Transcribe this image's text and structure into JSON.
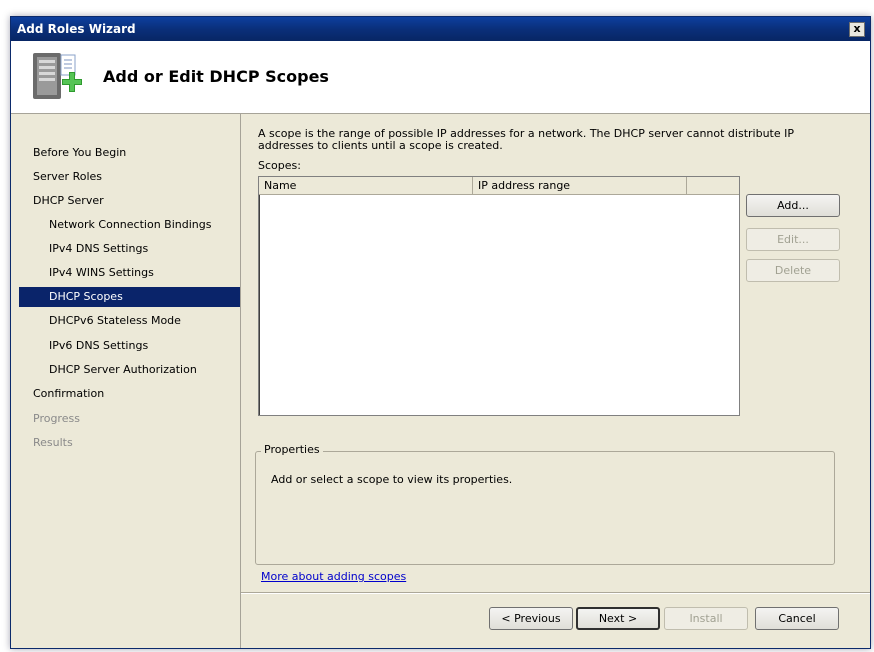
{
  "window": {
    "title": "Add Roles Wizard",
    "close_glyph": "x"
  },
  "header": {
    "title": "Add or Edit DHCP Scopes",
    "icon": "server-add-icon"
  },
  "nav": {
    "items": [
      {
        "label": "Before You Begin",
        "level": 0,
        "state": "normal"
      },
      {
        "label": "Server Roles",
        "level": 0,
        "state": "normal"
      },
      {
        "label": "DHCP Server",
        "level": 0,
        "state": "normal"
      },
      {
        "label": "Network Connection Bindings",
        "level": 1,
        "state": "normal"
      },
      {
        "label": "IPv4 DNS Settings",
        "level": 1,
        "state": "normal"
      },
      {
        "label": "IPv4 WINS Settings",
        "level": 1,
        "state": "normal"
      },
      {
        "label": "DHCP Scopes",
        "level": 1,
        "state": "selected"
      },
      {
        "label": "DHCPv6 Stateless Mode",
        "level": 1,
        "state": "normal"
      },
      {
        "label": "IPv6 DNS Settings",
        "level": 1,
        "state": "normal"
      },
      {
        "label": "DHCP Server Authorization",
        "level": 1,
        "state": "normal"
      },
      {
        "label": "Confirmation",
        "level": 0,
        "state": "normal"
      },
      {
        "label": "Progress",
        "level": 0,
        "state": "disabled"
      },
      {
        "label": "Results",
        "level": 0,
        "state": "disabled"
      }
    ]
  },
  "main": {
    "description_line1": "A scope is the range of possible IP addresses for a network. The DHCP server cannot distribute IP",
    "description_line2": "addresses to clients until a scope is created.",
    "scopes_label": "Scopes:",
    "columns": [
      "Name",
      "IP address range",
      ""
    ],
    "rows": [],
    "buttons": {
      "add": "Add...",
      "edit": "Edit...",
      "delete": "Delete"
    },
    "properties": {
      "legend": "Properties",
      "text": "Add or select a scope to view its properties."
    },
    "more_link": "More about adding scopes"
  },
  "footer": {
    "previous": "< Previous",
    "next": "Next >",
    "install": "Install",
    "cancel": "Cancel"
  }
}
